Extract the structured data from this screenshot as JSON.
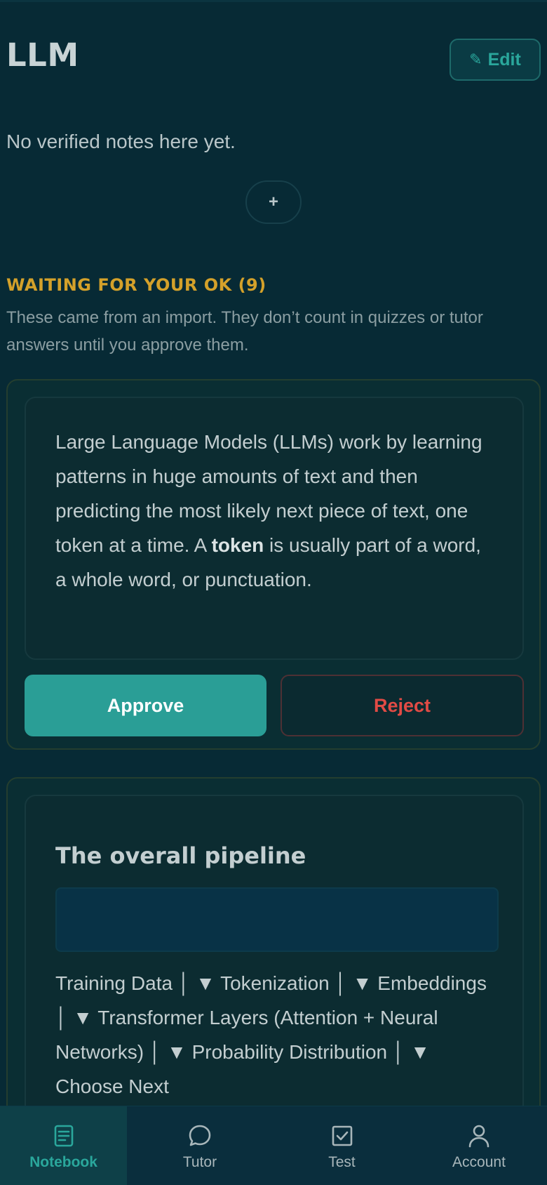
{
  "header": {
    "title": "LLM",
    "edit_label": "Edit",
    "edit_icon": "pencil-icon"
  },
  "verified": {
    "empty_text": "No verified notes here yet.",
    "add_label": "+"
  },
  "pending": {
    "heading": "WAITING FOR YOUR OK (9)",
    "description": "These came from an import. They don’t count in quizzes or tutor answers until you approve them.",
    "cards": [
      {
        "text_before": "Large Language Models (LLMs) work by learning patterns in huge amounts of text and then predicting the most likely next piece of text, one token at a time. A ",
        "text_bold": "token",
        "text_after": " is usually part of a word, a whole word, or punctuation.",
        "approve_label": "Approve",
        "reject_label": "Reject"
      },
      {
        "heading": "The overall pipeline",
        "text": "Training Data │ ▼ Tokenization │ ▼ Embeddings │ ▼ Transformer Layers (Attention + Neural Networks) │ ▼ Probability Distribution │ ▼ Choose Next"
      }
    ]
  },
  "nav": {
    "items": [
      {
        "label": "Notebook",
        "icon": "notebook-icon",
        "active": true
      },
      {
        "label": "Tutor",
        "icon": "chat-bubble-icon",
        "active": false
      },
      {
        "label": "Test",
        "icon": "checkbox-icon",
        "active": false
      },
      {
        "label": "Account",
        "icon": "person-icon",
        "active": false
      }
    ]
  },
  "colors": {
    "background": "#072a35",
    "accent": "#2a9e96",
    "warning": "#d4a12a",
    "danger": "#e14b45"
  }
}
